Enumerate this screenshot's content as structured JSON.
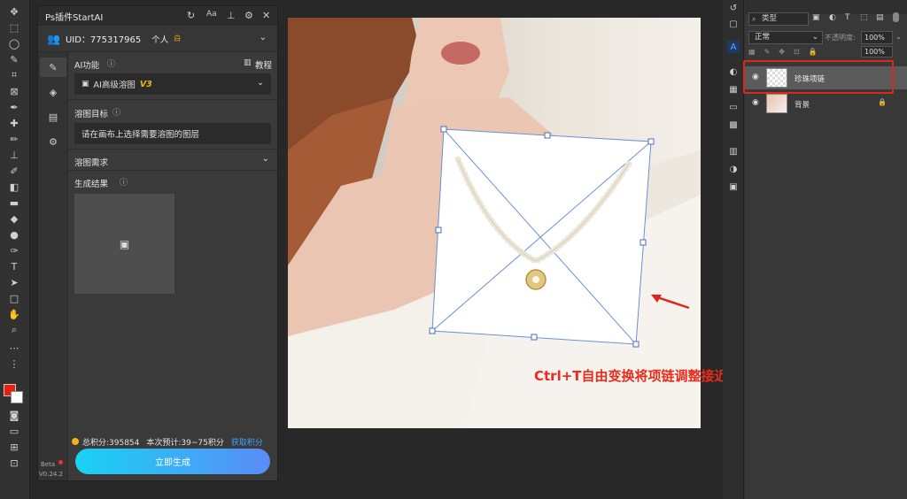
{
  "plugin": {
    "title": "Ps插件StartAI",
    "title_icons": [
      "refresh-icon",
      "font-size-icon",
      "pin-icon",
      "settings-icon",
      "close-icon"
    ],
    "uid_label": "UID：775317965",
    "account_type": "个人",
    "account_badge": "白",
    "ai_function_label": "AI功能",
    "tutorial_label": "教程",
    "selected_function": "AI高级溶图",
    "function_version": "V3",
    "blend_target_label": "溶图目标",
    "blend_target_placeholder": "请在画布上选择需要溶图的图层",
    "blend_requirement_label": "溶图需求",
    "result_label": "生成结果",
    "total_points": "总积分:395854",
    "estimated_points": "本次预计:39~75积分",
    "get_points_label": "获取积分",
    "generate_button": "立即生成",
    "beta_label": "Beta",
    "version": "V0.24.2"
  },
  "annotation": {
    "text": "Ctrl+T自由变换将项链调整接近真实佩戴角度",
    "color": "#ee2a1a"
  },
  "layers_panel": {
    "filter_type": "类型",
    "blend_mode": "正常",
    "opacity_label": "不透明度:",
    "opacity_value": "100%",
    "fill_value": "100%",
    "layers": [
      {
        "name": "珍珠项链",
        "selected": true,
        "highlighted": true
      },
      {
        "name": "背景",
        "selected": false,
        "locked": true
      }
    ]
  },
  "colors": {
    "foreground": "#e8200f",
    "background": "#ffffff",
    "accent": "#3ea6ff",
    "highlight_box": "#e0261b"
  }
}
